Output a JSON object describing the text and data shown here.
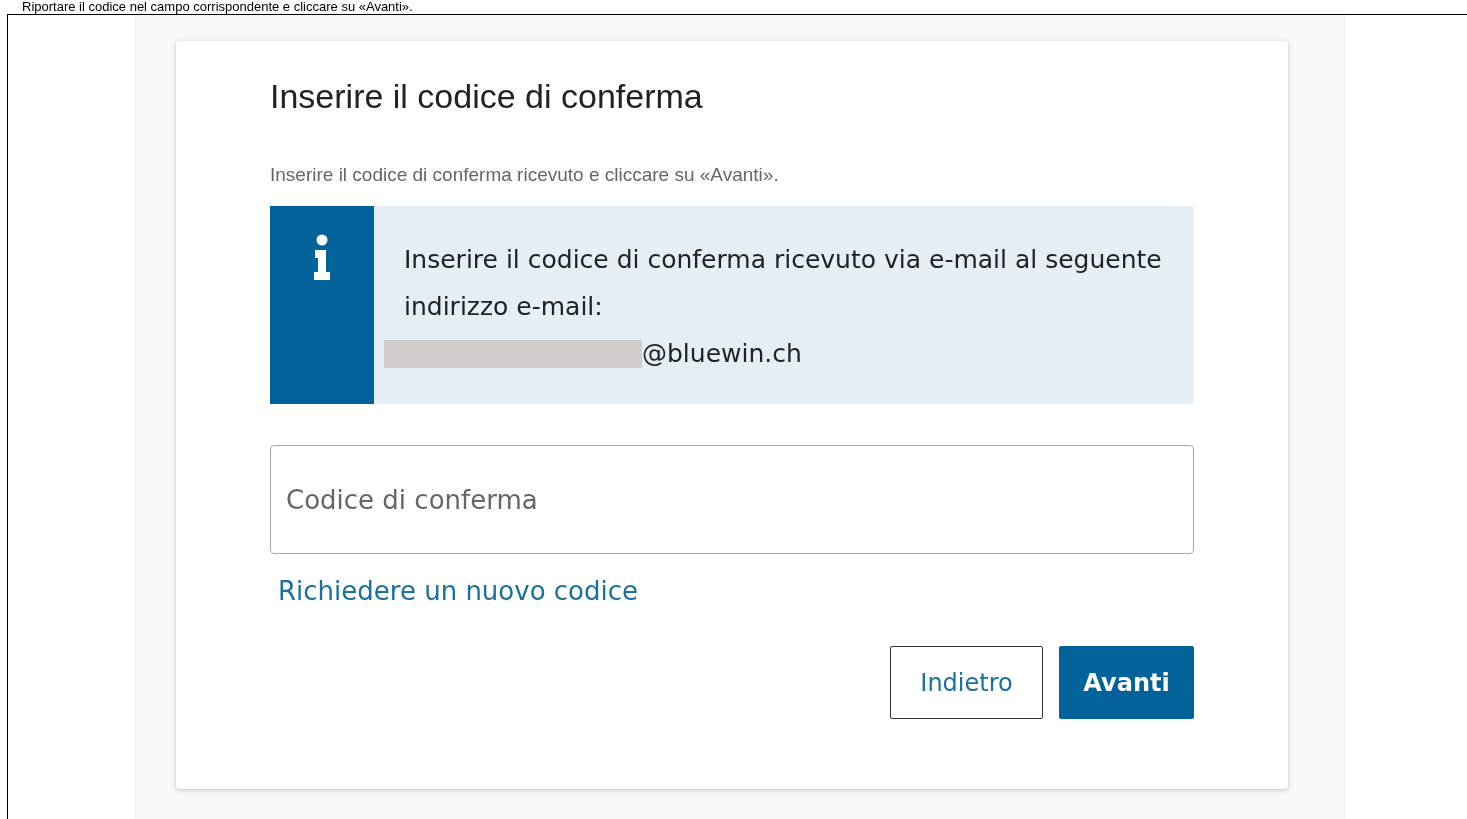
{
  "caption": "Riportare il codice nel campo corrispondente e cliccare su «Avanti».",
  "title": "Inserire il codice di conferma",
  "subtitle": "Inserire il codice di conferma ricevuto e cliccare su «Avanti».",
  "info": {
    "message": "Inserire il codice di conferma ricevuto via e-mail al seguente indirizzo e-mail:",
    "email_domain": "@bluewin.ch",
    "redacted": true
  },
  "code_field": {
    "placeholder": "Codice di conferma"
  },
  "resend_link": "Richiedere un nuovo codice",
  "buttons": [
    {
      "label": "Indietro",
      "kind": "secondary"
    },
    {
      "label": "Avanti",
      "kind": "primary"
    }
  ]
}
